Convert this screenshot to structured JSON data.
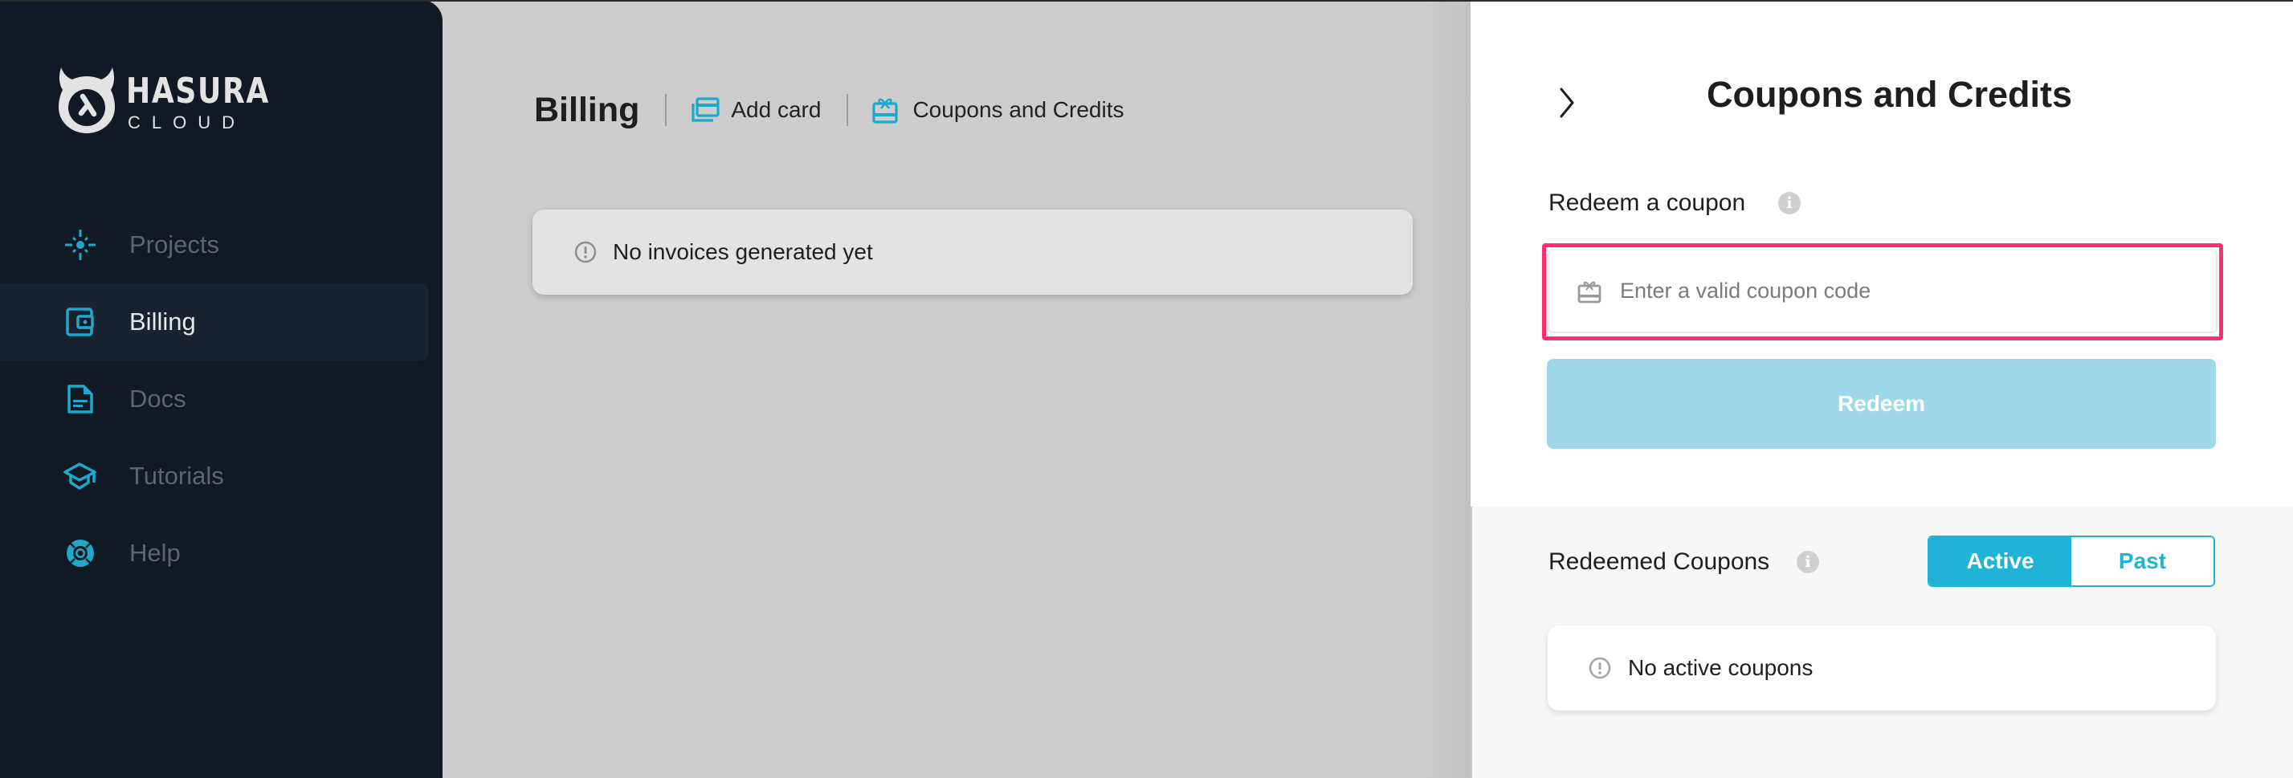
{
  "brand": {
    "name": "HASURA",
    "product": "CLOUD"
  },
  "sidebar": {
    "items": [
      {
        "label": "Projects",
        "icon": "projects-icon",
        "active": false
      },
      {
        "label": "Billing",
        "icon": "wallet-icon",
        "active": true
      },
      {
        "label": "Docs",
        "icon": "document-icon",
        "active": false
      },
      {
        "label": "Tutorials",
        "icon": "graduation-cap-icon",
        "active": false
      },
      {
        "label": "Help",
        "icon": "lifebuoy-icon",
        "active": false
      }
    ]
  },
  "header": {
    "title": "Billing",
    "add_card_label": "Add card",
    "coupons_label": "Coupons and Credits"
  },
  "invoices": {
    "empty_message": "No invoices generated yet"
  },
  "panel": {
    "title": "Coupons and Credits",
    "redeem_label": "Redeem a coupon",
    "coupon_input": {
      "value": "",
      "placeholder": "Enter a valid coupon code"
    },
    "redeem_button": "Redeem",
    "redeemed_label": "Redeemed Coupons",
    "toggle": {
      "options": [
        "Active",
        "Past"
      ],
      "selected": "Active"
    },
    "empty_message": "No active coupons"
  },
  "colors": {
    "accent": "#1fb4d6",
    "sidebar_bg": "#101924",
    "focus_outline": "#ff2d6e",
    "redeem_disabled": "#9fd8ea"
  }
}
